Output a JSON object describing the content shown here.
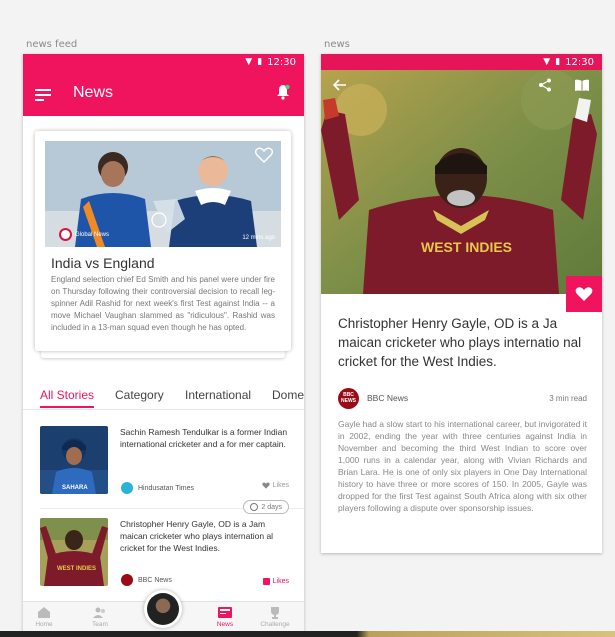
{
  "colors": {
    "accent": "#f0135e",
    "statusbar": "#e6155a"
  },
  "captions": {
    "left": "news feed",
    "right": "news"
  },
  "status_bar": {
    "time": "12:30"
  },
  "feed": {
    "title": "News",
    "featured": {
      "source": "Global News",
      "time": "12 mins ago",
      "title": "India vs England",
      "summary": "England selection chief Ed Smith and his panel were under fire on Thursday following their controversial decision to recall leg-spinner Adil Rashid for next week's first Test against India -- a move Michael Vaughan slammed as \"ridiculous\". Rashid was included in a 13-man squad even though he has opted."
    },
    "tabs": [
      "All Stories",
      "Category",
      "International",
      "Dome"
    ],
    "stories": [
      {
        "text": "Sachin Ramesh Tendulkar is a former Indian international cricketer and a for mer captain.",
        "source": "Hindusatan Times",
        "likes": "Likes",
        "liked": false
      },
      {
        "text": "Christopher Henry Gayle, OD is a Jam maican cricketer who plays internation al cricket for the West Indies.",
        "source": "BBC News",
        "likes": "Likes",
        "liked": true
      }
    ],
    "time_pill": "2 days",
    "nav": [
      {
        "label": "Home",
        "icon": "home-icon"
      },
      {
        "label": "Team",
        "icon": "team-icon"
      },
      {
        "label": "News",
        "icon": "news-icon",
        "active": true
      },
      {
        "label": "Challenge",
        "icon": "trophy-icon"
      }
    ]
  },
  "article": {
    "title": "Christopher Henry Gayle, OD is a Ja maican cricketer who plays internatio nal cricket for the West Indies.",
    "source": "BBC News",
    "source_logo": "BBC NEWS",
    "read_time": "3 min read",
    "body": "Gayle had a slow start to his international career, but invigorated it in 2002, ending the year with three centuries against India in November and becoming the third West Indian to score over 1,000 runs in a calendar year, along with Vivian Richards and Brian Lara. He is one of only six players in One Day International history to have three or more scores of 150. In 2005, Gayle was dropped for the first Test against South Africa along with six other players following a dispute over sponsorship issues.",
    "jersey": "WEST INDIES"
  },
  "image_labels": {
    "sahara": "SAHARA",
    "west_indies_small": "WEST INDIES"
  }
}
